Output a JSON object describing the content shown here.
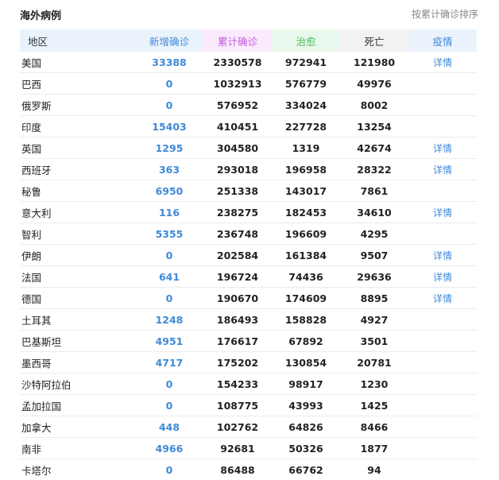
{
  "header": {
    "title": "海外病例",
    "sort_label": "按累计确诊排序"
  },
  "columns": {
    "region": "地区",
    "new_confirmed": "新增确诊",
    "total_confirmed": "累计确诊",
    "cured": "治愈",
    "deaths": "死亡",
    "detail": "疫情"
  },
  "detail_label": "详情",
  "rows": [
    {
      "region": "美国",
      "new": "33388",
      "total": "2330578",
      "cured": "972941",
      "deaths": "121980",
      "detail": "详情"
    },
    {
      "region": "巴西",
      "new": "0",
      "total": "1032913",
      "cured": "576779",
      "deaths": "49976",
      "detail": ""
    },
    {
      "region": "俄罗斯",
      "new": "0",
      "total": "576952",
      "cured": "334024",
      "deaths": "8002",
      "detail": ""
    },
    {
      "region": "印度",
      "new": "15403",
      "total": "410451",
      "cured": "227728",
      "deaths": "13254",
      "detail": ""
    },
    {
      "region": "英国",
      "new": "1295",
      "total": "304580",
      "cured": "1319",
      "deaths": "42674",
      "detail": "详情"
    },
    {
      "region": "西班牙",
      "new": "363",
      "total": "293018",
      "cured": "196958",
      "deaths": "28322",
      "detail": "详情"
    },
    {
      "region": "秘鲁",
      "new": "6950",
      "total": "251338",
      "cured": "143017",
      "deaths": "7861",
      "detail": ""
    },
    {
      "region": "意大利",
      "new": "116",
      "total": "238275",
      "cured": "182453",
      "deaths": "34610",
      "detail": "详情"
    },
    {
      "region": "智利",
      "new": "5355",
      "total": "236748",
      "cured": "196609",
      "deaths": "4295",
      "detail": ""
    },
    {
      "region": "伊朗",
      "new": "0",
      "total": "202584",
      "cured": "161384",
      "deaths": "9507",
      "detail": "详情"
    },
    {
      "region": "法国",
      "new": "641",
      "total": "196724",
      "cured": "74436",
      "deaths": "29636",
      "detail": "详情"
    },
    {
      "region": "德国",
      "new": "0",
      "total": "190670",
      "cured": "174609",
      "deaths": "8895",
      "detail": "详情"
    },
    {
      "region": "土耳其",
      "new": "1248",
      "total": "186493",
      "cured": "158828",
      "deaths": "4927",
      "detail": ""
    },
    {
      "region": "巴基斯坦",
      "new": "4951",
      "total": "176617",
      "cured": "67892",
      "deaths": "3501",
      "detail": ""
    },
    {
      "region": "墨西哥",
      "new": "4717",
      "total": "175202",
      "cured": "130854",
      "deaths": "20781",
      "detail": ""
    },
    {
      "region": "沙特阿拉伯",
      "new": "0",
      "total": "154233",
      "cured": "98917",
      "deaths": "1230",
      "detail": ""
    },
    {
      "region": "孟加拉国",
      "new": "0",
      "total": "108775",
      "cured": "43993",
      "deaths": "1425",
      "detail": ""
    },
    {
      "region": "加拿大",
      "new": "448",
      "total": "102762",
      "cured": "64826",
      "deaths": "8466",
      "detail": ""
    },
    {
      "region": "南非",
      "new": "4966",
      "total": "92681",
      "cured": "50326",
      "deaths": "1877",
      "detail": ""
    },
    {
      "region": "卡塔尔",
      "new": "0",
      "total": "86488",
      "cured": "66762",
      "deaths": "94",
      "detail": ""
    }
  ],
  "colors": {
    "blue_accent": "#3f8ad8",
    "purple_accent": "#c25be0",
    "green_accent": "#49b957"
  }
}
